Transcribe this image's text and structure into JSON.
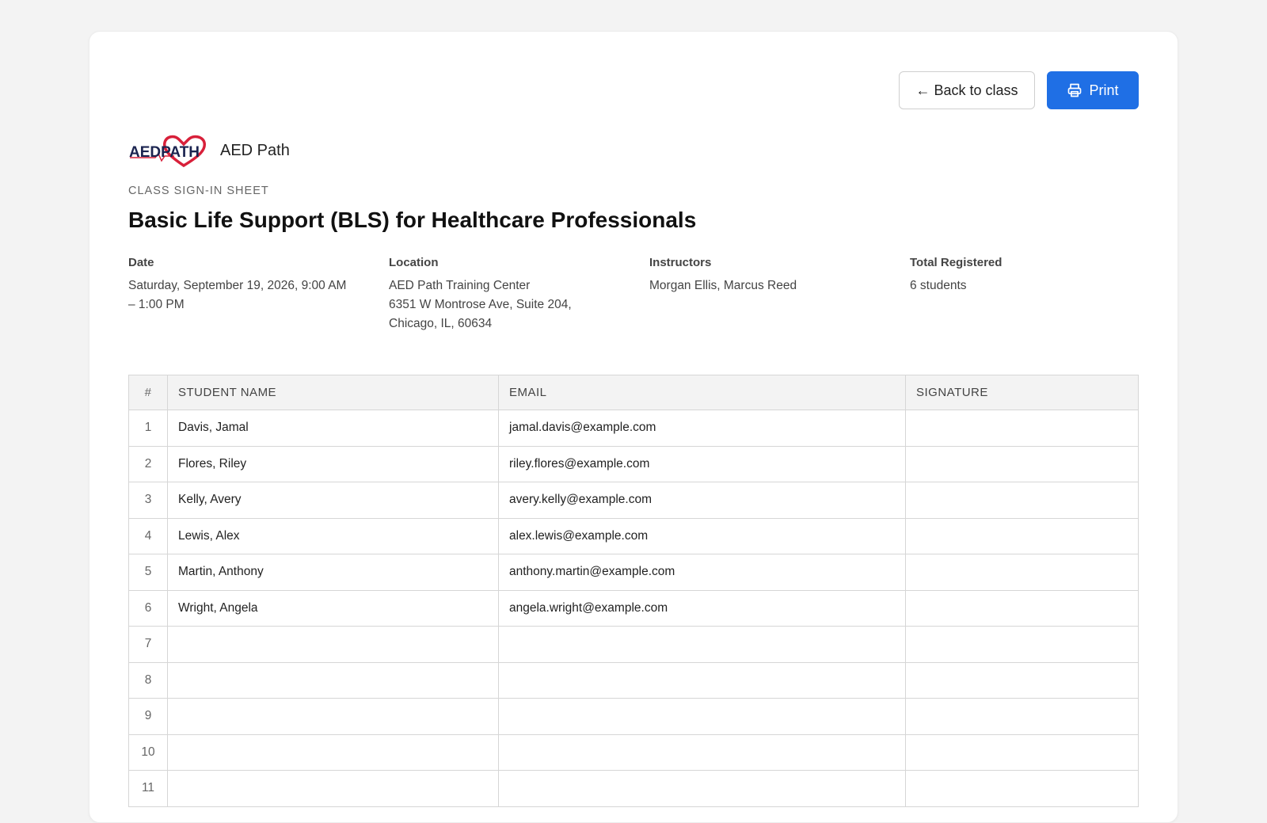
{
  "toolbar": {
    "back_label": "← Back to class",
    "print_label": "Print",
    "print_icon": "printer-icon"
  },
  "brand": {
    "logo_text": "AEDPATH",
    "name": "AED Path"
  },
  "sheet": {
    "eyebrow": "CLASS SIGN-IN SHEET",
    "title": "Basic Life Support (BLS) for Healthcare Professionals"
  },
  "meta": {
    "date_label": "Date",
    "date_value": "Saturday, September 19, 2026, 9:00 AM\n– 1:00 PM",
    "location_label": "Location",
    "location_value": "AED Path Training Center\n6351 W Montrose Ave, Suite 204,\nChicago, IL, 60634",
    "instructors_label": "Instructors",
    "instructors_value": "Morgan Ellis, Marcus Reed",
    "total_label": "Total Registered",
    "total_value": "6 students"
  },
  "table": {
    "headers": [
      "#",
      "STUDENT NAME",
      "EMAIL",
      "SIGNATURE"
    ],
    "rows": [
      {
        "num": "1",
        "name": "Davis, Jamal",
        "email": "jamal.davis@example.com"
      },
      {
        "num": "2",
        "name": "Flores, Riley",
        "email": "riley.flores@example.com"
      },
      {
        "num": "3",
        "name": "Kelly, Avery",
        "email": "avery.kelly@example.com"
      },
      {
        "num": "4",
        "name": "Lewis, Alex",
        "email": "alex.lewis@example.com"
      },
      {
        "num": "5",
        "name": "Martin, Anthony",
        "email": "anthony.martin@example.com"
      },
      {
        "num": "6",
        "name": "Wright, Angela",
        "email": "angela.wright@example.com"
      },
      {
        "num": "7",
        "name": "",
        "email": ""
      },
      {
        "num": "8",
        "name": "",
        "email": ""
      },
      {
        "num": "9",
        "name": "",
        "email": ""
      },
      {
        "num": "10",
        "name": "",
        "email": ""
      },
      {
        "num": "11",
        "name": "",
        "email": ""
      }
    ]
  },
  "colors": {
    "accent": "#1f6fe5",
    "logo_red": "#d8203a",
    "logo_navy": "#1b2450"
  }
}
